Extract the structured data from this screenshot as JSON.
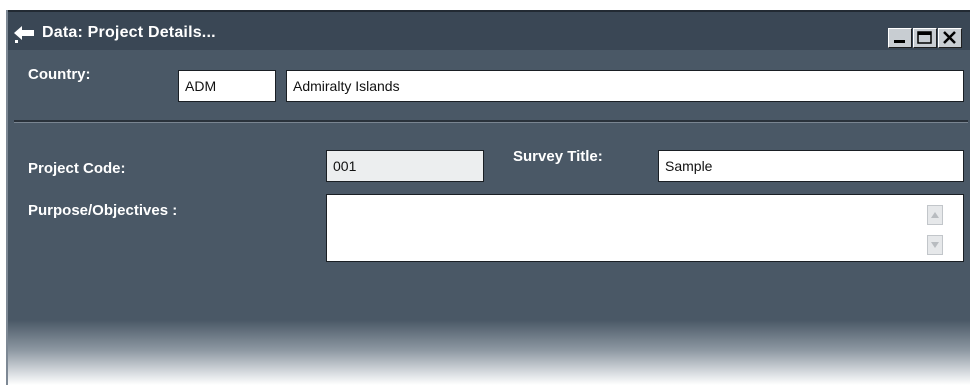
{
  "window": {
    "title": "Data: Project Details..."
  },
  "icons": {
    "window": "data-window-icon",
    "minimize": "minimize-icon",
    "maximize": "maximize-icon",
    "close": "close-icon",
    "scroll_up": "scroll-up-icon",
    "scroll_down": "scroll-down-icon"
  },
  "country": {
    "label": "Country:",
    "code": "ADM",
    "name": "Admiralty Islands"
  },
  "project": {
    "code_label": "Project Code:",
    "code_value": "001",
    "survey_title_label": "Survey Title:",
    "survey_title_value": "Sample",
    "purpose_label": "Purpose/Objectives :",
    "purpose_value": ""
  },
  "colors": {
    "background": "#4a5866",
    "titlebar": "#3a4755",
    "label_text": "#ffffff"
  }
}
